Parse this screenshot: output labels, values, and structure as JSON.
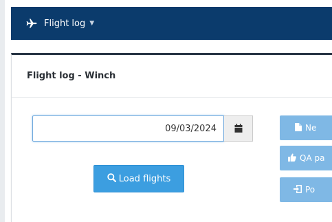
{
  "navbar": {
    "menu_label": "Flight log",
    "menu_icon": "airplane-icon",
    "caret_icon": "caret-down-icon"
  },
  "panel": {
    "title": "Flight log - Winch"
  },
  "form": {
    "date_value": "09/03/2024",
    "calendar_icon": "calendar-icon"
  },
  "buttons": {
    "load_flights": "Load flights",
    "new_label": "Ne",
    "qa_label": "QA pa",
    "post_label": "Po"
  },
  "colors": {
    "navbar_bg": "#0b3b6c",
    "primary": "#3c9ee0",
    "primary_light": "#7fb8e5",
    "panel_border": "#283544"
  }
}
